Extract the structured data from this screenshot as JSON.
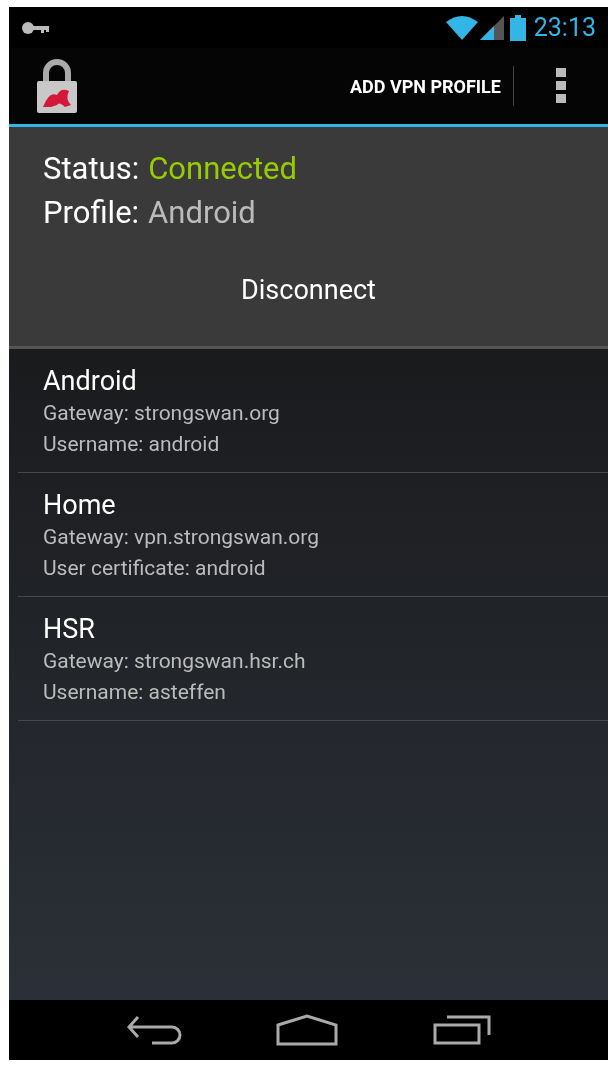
{
  "status_bar": {
    "time": "23:13"
  },
  "action_bar": {
    "add_button": "ADD VPN PROFILE"
  },
  "status_panel": {
    "status_label": "Status:",
    "status_value": "Connected",
    "profile_label": "Profile:",
    "profile_value": "Android",
    "disconnect_button": "Disconnect"
  },
  "profiles": [
    {
      "name": "Android",
      "gateway": "Gateway: strongswan.org",
      "auth": "Username: android"
    },
    {
      "name": "Home",
      "gateway": "Gateway: vpn.strongswan.org",
      "auth": "User certificate: android"
    },
    {
      "name": "HSR",
      "gateway": "Gateway: strongswan.hsr.ch",
      "auth": "Username: asteffen"
    }
  ]
}
